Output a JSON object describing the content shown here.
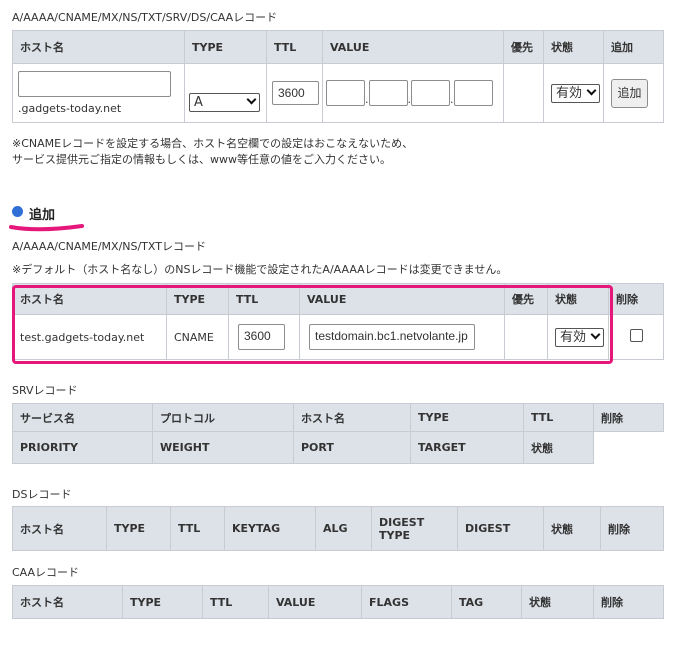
{
  "top_section": {
    "heading": "A/AAAA/CNAME/MX/NS/TXT/SRV/DS/CAAレコード",
    "headers": {
      "host": "ホスト名",
      "type": "TYPE",
      "ttl": "TTL",
      "value": "VALUE",
      "priority": "優先",
      "status": "状態",
      "add": "追加"
    },
    "host_value": "",
    "domain_suffix": ".gadgets-today.net",
    "type_selected": "A",
    "ttl_value": "3600",
    "value_parts": [
      "",
      "",
      "",
      ""
    ],
    "dot": ".",
    "status_selected": "有効",
    "add_button": "追加",
    "note_line1": "※CNAMEレコードを設定する場合、ホスト名空欄での設定はおこなえないため、",
    "note_line2": "サービス提供元ご指定の情報もしくは、www等任意の値をご入力ください。"
  },
  "added_section": {
    "title": "追加",
    "subheading": "A/AAAA/CNAME/MX/NS/TXTレコード",
    "note": "※デフォルト（ホスト名なし）のNSレコード機能で設定されたA/AAAAレコードは変更できません。",
    "headers": {
      "host": "ホスト名",
      "type": "TYPE",
      "ttl": "TTL",
      "value": "VALUE",
      "priority": "優先",
      "status": "状態",
      "delete": "削除"
    },
    "row": {
      "host": "test.gadgets-today.net",
      "type": "CNAME",
      "ttl": "3600",
      "value": "testdomain.bc1.netvolante.jp",
      "priority": "",
      "status": "有効"
    }
  },
  "srv_section": {
    "heading": "SRVレコード",
    "row1": [
      "サービス名",
      "プロトコル",
      "ホスト名",
      "TYPE",
      "TTL",
      "削除"
    ],
    "row2": [
      "PRIORITY",
      "WEIGHT",
      "PORT",
      "TARGET",
      "状態"
    ]
  },
  "ds_section": {
    "heading": "DSレコード",
    "headers": [
      "ホスト名",
      "TYPE",
      "TTL",
      "KEYTAG",
      "ALG",
      "DIGEST TYPE",
      "DIGEST",
      "状態",
      "削除"
    ]
  },
  "caa_section": {
    "heading": "CAAレコード",
    "headers": [
      "ホスト名",
      "TYPE",
      "TTL",
      "VALUE",
      "FLAGS",
      "TAG",
      "状態",
      "削除"
    ]
  },
  "colors": {
    "highlight": "#e6177a",
    "bullet": "#2f6fd6",
    "header_bg": "#dde2e8"
  }
}
